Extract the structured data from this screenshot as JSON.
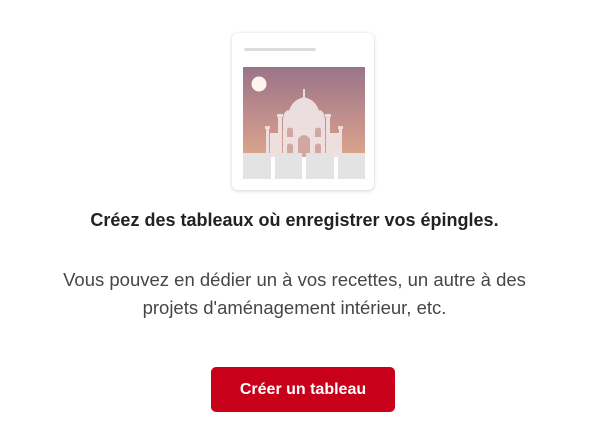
{
  "illustration": {
    "icon": "taj-mahal-pin-board-illustration",
    "gradient_top": "#9a7488",
    "gradient_bottom": "#d9a38c",
    "sun_color": "#fff5ec",
    "silhouette_color": "#f1e7e7"
  },
  "empty_state": {
    "title": "Créez des tableaux où enregistrer vos épingles.",
    "description": "Vous pouvez en dédier un à vos recettes, un autre à des projets d'aménagement intérieur, etc."
  },
  "actions": {
    "create_board_label": "Créer un tableau",
    "accent_color": "#c8001a"
  }
}
